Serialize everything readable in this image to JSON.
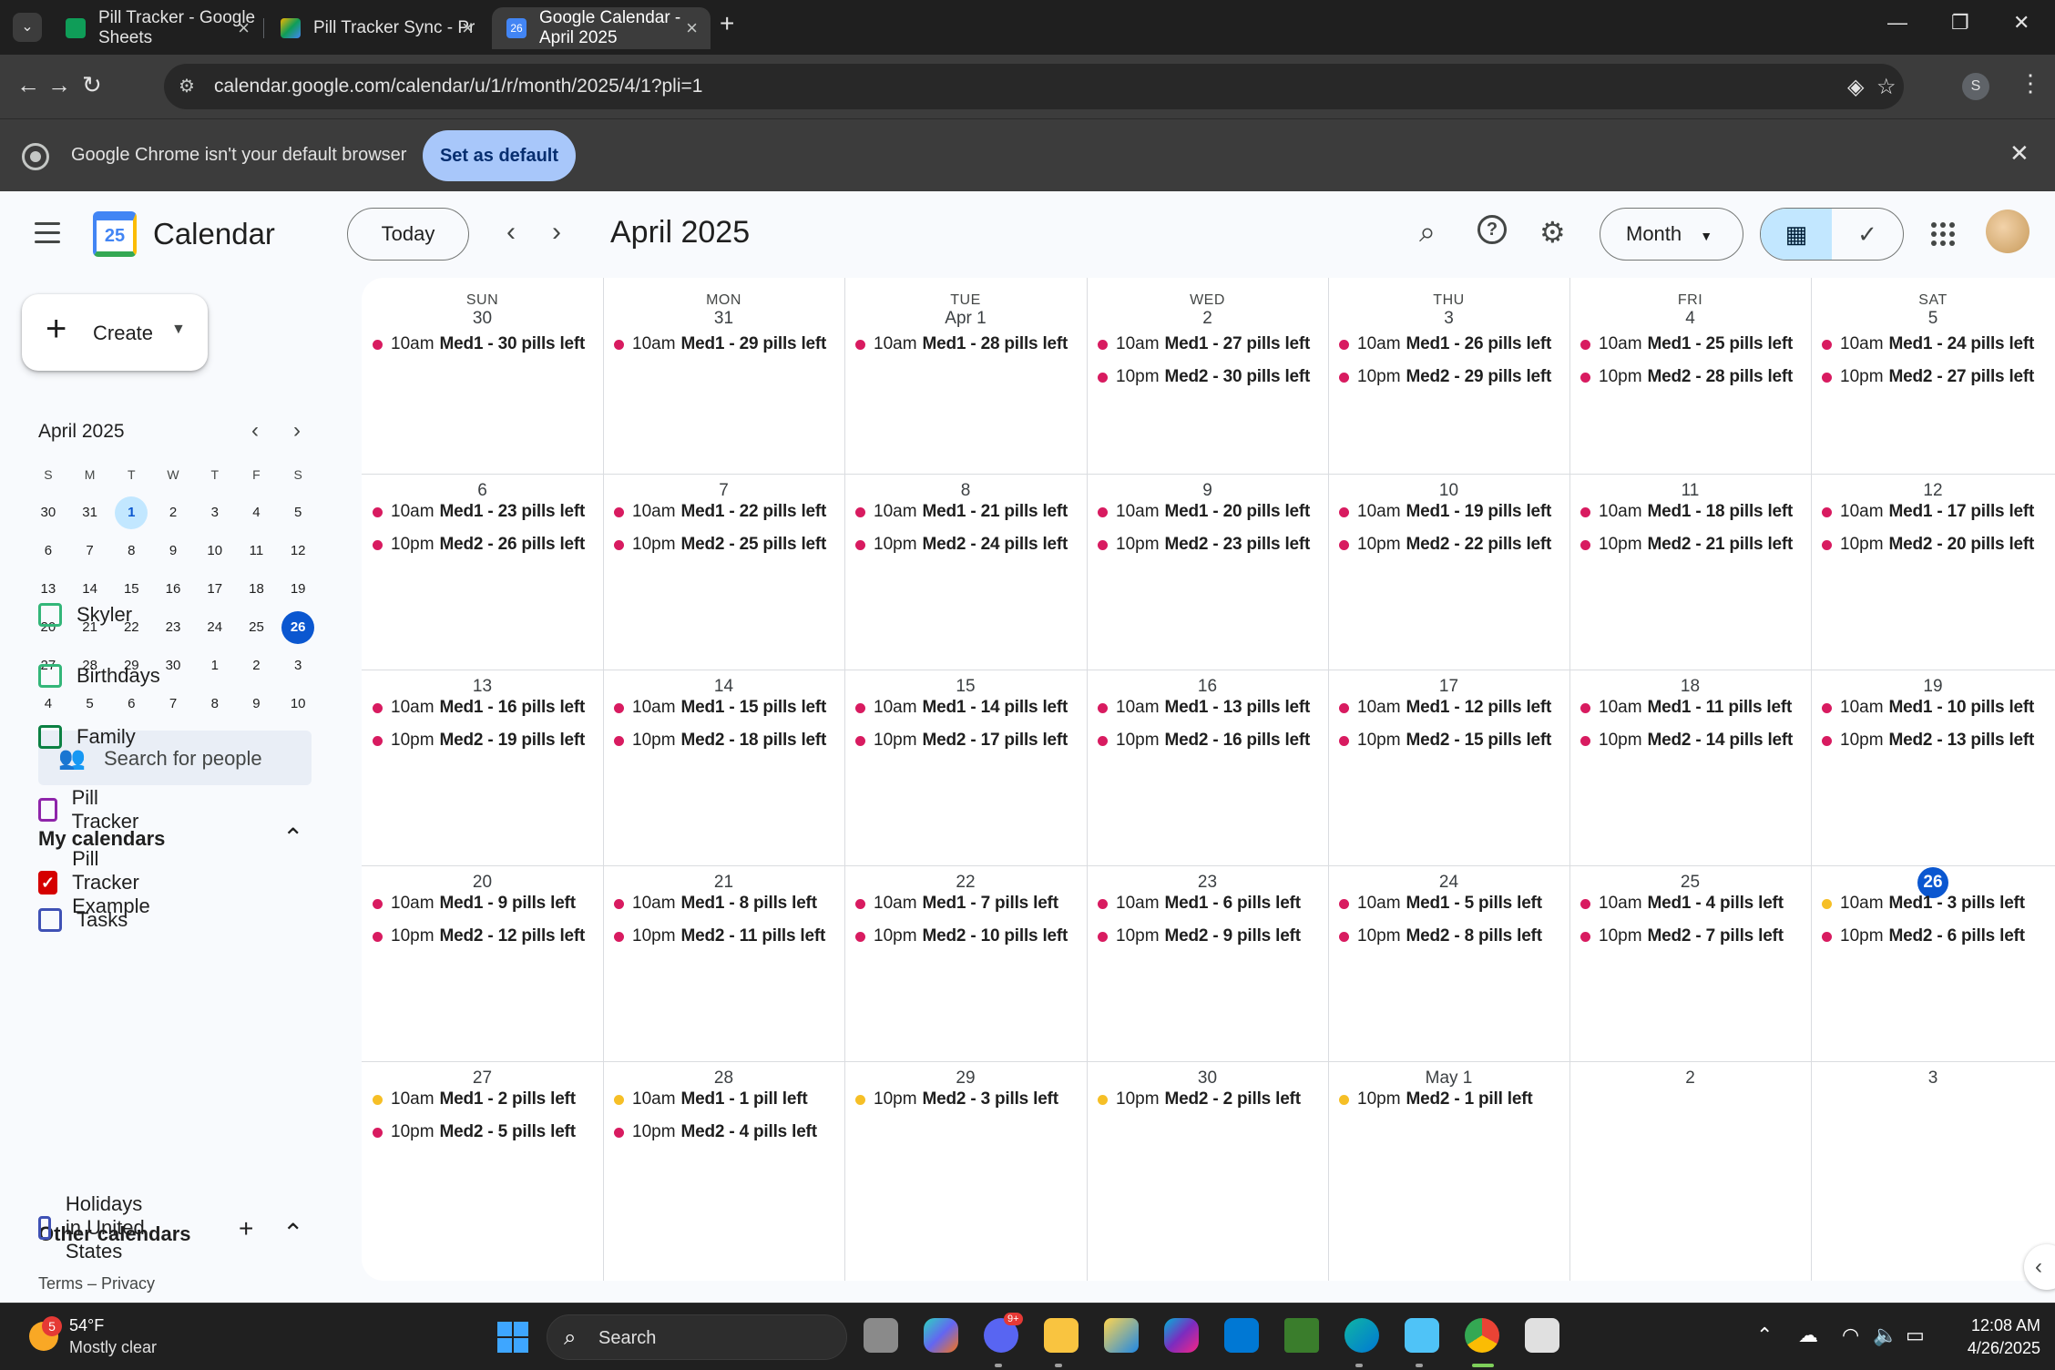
{
  "browser": {
    "tabs": [
      {
        "title": "Pill Tracker - Google Sheets",
        "favicon_color": "#0f9d58"
      },
      {
        "title": "Pill Tracker Sync - Project Editor",
        "favicon_color": "#f4b400"
      },
      {
        "title": "Google Calendar - April 2025",
        "favicon_color": "#4285f4",
        "favicon_text": "26"
      }
    ],
    "url": "calendar.google.com/calendar/u/1/r/month/2025/4/1?pli=1",
    "profile_initial": "S",
    "infobar": {
      "message": "Google Chrome isn't your default browser",
      "button": "Set as default"
    }
  },
  "header": {
    "logo_number": "25",
    "app_name": "Calendar",
    "today_label": "Today",
    "month_title": "April 2025",
    "view_label": "Month"
  },
  "sidebar": {
    "create_label": "Create",
    "mini_cal": {
      "title": "April 2025",
      "dow": [
        "S",
        "M",
        "T",
        "W",
        "T",
        "F",
        "S"
      ],
      "weeks": [
        [
          "30",
          "31",
          "1",
          "2",
          "3",
          "4",
          "5"
        ],
        [
          "6",
          "7",
          "8",
          "9",
          "10",
          "11",
          "12"
        ],
        [
          "13",
          "14",
          "15",
          "16",
          "17",
          "18",
          "19"
        ],
        [
          "20",
          "21",
          "22",
          "23",
          "24",
          "25",
          "26"
        ],
        [
          "27",
          "28",
          "29",
          "30",
          "1",
          "2",
          "3"
        ],
        [
          "4",
          "5",
          "6",
          "7",
          "8",
          "9",
          "10"
        ]
      ]
    },
    "search_people": "Search for people",
    "my_calendars_title": "My calendars",
    "my_calendars": [
      {
        "name": "Skyler",
        "color": "#33b679",
        "checked": false
      },
      {
        "name": "Birthdays",
        "color": "#33b679",
        "checked": false
      },
      {
        "name": "Family",
        "color": "#0b8043",
        "checked": false
      },
      {
        "name": "Pill Tracker",
        "color": "#8e24aa",
        "checked": false
      },
      {
        "name": "Pill Tracker Example",
        "color": "#d50000",
        "checked": true
      },
      {
        "name": "Tasks",
        "color": "#3f51b5",
        "checked": false
      }
    ],
    "other_calendars_title": "Other calendars",
    "other_calendars": [
      {
        "name": "Holidays in United States",
        "color": "#3f51b5",
        "checked": false
      }
    ],
    "terms": "Terms – Privacy"
  },
  "grid": {
    "dow": [
      "SUN",
      "MON",
      "TUE",
      "WED",
      "THU",
      "FRI",
      "SAT"
    ],
    "colors": {
      "pink": "#d81b60",
      "yellow": "#f6bf26"
    },
    "weeks": [
      [
        {
          "day": "30",
          "events": [
            {
              "time": "10am",
              "name": "Med1 - 30 pills left",
              "c": "pink"
            }
          ]
        },
        {
          "day": "31",
          "events": [
            {
              "time": "10am",
              "name": "Med1 - 29 pills left",
              "c": "pink"
            }
          ]
        },
        {
          "day": "Apr 1",
          "events": [
            {
              "time": "10am",
              "name": "Med1 - 28 pills left",
              "c": "pink"
            }
          ]
        },
        {
          "day": "2",
          "events": [
            {
              "time": "10am",
              "name": "Med1 - 27 pills left",
              "c": "pink"
            },
            {
              "time": "10pm",
              "name": "Med2 - 30 pills left",
              "c": "pink"
            }
          ]
        },
        {
          "day": "3",
          "events": [
            {
              "time": "10am",
              "name": "Med1 - 26 pills left",
              "c": "pink"
            },
            {
              "time": "10pm",
              "name": "Med2 - 29 pills left",
              "c": "pink"
            }
          ]
        },
        {
          "day": "4",
          "events": [
            {
              "time": "10am",
              "name": "Med1 - 25 pills left",
              "c": "pink"
            },
            {
              "time": "10pm",
              "name": "Med2 - 28 pills left",
              "c": "pink"
            }
          ]
        },
        {
          "day": "5",
          "events": [
            {
              "time": "10am",
              "name": "Med1 - 24 pills left",
              "c": "pink"
            },
            {
              "time": "10pm",
              "name": "Med2 - 27 pills left",
              "c": "pink"
            }
          ]
        }
      ],
      [
        {
          "day": "6",
          "events": [
            {
              "time": "10am",
              "name": "Med1 - 23 pills left",
              "c": "pink"
            },
            {
              "time": "10pm",
              "name": "Med2 - 26 pills left",
              "c": "pink"
            }
          ]
        },
        {
          "day": "7",
          "events": [
            {
              "time": "10am",
              "name": "Med1 - 22 pills left",
              "c": "pink"
            },
            {
              "time": "10pm",
              "name": "Med2 - 25 pills left",
              "c": "pink"
            }
          ]
        },
        {
          "day": "8",
          "events": [
            {
              "time": "10am",
              "name": "Med1 - 21 pills left",
              "c": "pink"
            },
            {
              "time": "10pm",
              "name": "Med2 - 24 pills left",
              "c": "pink"
            }
          ]
        },
        {
          "day": "9",
          "events": [
            {
              "time": "10am",
              "name": "Med1 - 20 pills left",
              "c": "pink"
            },
            {
              "time": "10pm",
              "name": "Med2 - 23 pills left",
              "c": "pink"
            }
          ]
        },
        {
          "day": "10",
          "events": [
            {
              "time": "10am",
              "name": "Med1 - 19 pills left",
              "c": "pink"
            },
            {
              "time": "10pm",
              "name": "Med2 - 22 pills left",
              "c": "pink"
            }
          ]
        },
        {
          "day": "11",
          "events": [
            {
              "time": "10am",
              "name": "Med1 - 18 pills left",
              "c": "pink"
            },
            {
              "time": "10pm",
              "name": "Med2 - 21 pills left",
              "c": "pink"
            }
          ]
        },
        {
          "day": "12",
          "events": [
            {
              "time": "10am",
              "name": "Med1 - 17 pills left",
              "c": "pink"
            },
            {
              "time": "10pm",
              "name": "Med2 - 20 pills left",
              "c": "pink"
            }
          ]
        }
      ],
      [
        {
          "day": "13",
          "events": [
            {
              "time": "10am",
              "name": "Med1 - 16 pills left",
              "c": "pink"
            },
            {
              "time": "10pm",
              "name": "Med2 - 19 pills left",
              "c": "pink"
            }
          ]
        },
        {
          "day": "14",
          "events": [
            {
              "time": "10am",
              "name": "Med1 - 15 pills left",
              "c": "pink"
            },
            {
              "time": "10pm",
              "name": "Med2 - 18 pills left",
              "c": "pink"
            }
          ]
        },
        {
          "day": "15",
          "events": [
            {
              "time": "10am",
              "name": "Med1 - 14 pills left",
              "c": "pink"
            },
            {
              "time": "10pm",
              "name": "Med2 - 17 pills left",
              "c": "pink"
            }
          ]
        },
        {
          "day": "16",
          "events": [
            {
              "time": "10am",
              "name": "Med1 - 13 pills left",
              "c": "pink"
            },
            {
              "time": "10pm",
              "name": "Med2 - 16 pills left",
              "c": "pink"
            }
          ]
        },
        {
          "day": "17",
          "events": [
            {
              "time": "10am",
              "name": "Med1 - 12 pills left",
              "c": "pink"
            },
            {
              "time": "10pm",
              "name": "Med2 - 15 pills left",
              "c": "pink"
            }
          ]
        },
        {
          "day": "18",
          "events": [
            {
              "time": "10am",
              "name": "Med1 - 11 pills left",
              "c": "pink"
            },
            {
              "time": "10pm",
              "name": "Med2 - 14 pills left",
              "c": "pink"
            }
          ]
        },
        {
          "day": "19",
          "events": [
            {
              "time": "10am",
              "name": "Med1 - 10 pills left",
              "c": "pink"
            },
            {
              "time": "10pm",
              "name": "Med2 - 13 pills left",
              "c": "pink"
            }
          ]
        }
      ],
      [
        {
          "day": "20",
          "events": [
            {
              "time": "10am",
              "name": "Med1 - 9 pills left",
              "c": "pink"
            },
            {
              "time": "10pm",
              "name": "Med2 - 12 pills left",
              "c": "pink"
            }
          ]
        },
        {
          "day": "21",
          "events": [
            {
              "time": "10am",
              "name": "Med1 - 8 pills left",
              "c": "pink"
            },
            {
              "time": "10pm",
              "name": "Med2 - 11 pills left",
              "c": "pink"
            }
          ]
        },
        {
          "day": "22",
          "events": [
            {
              "time": "10am",
              "name": "Med1 - 7 pills left",
              "c": "pink"
            },
            {
              "time": "10pm",
              "name": "Med2 - 10 pills left",
              "c": "pink"
            }
          ]
        },
        {
          "day": "23",
          "events": [
            {
              "time": "10am",
              "name": "Med1 - 6 pills left",
              "c": "pink"
            },
            {
              "time": "10pm",
              "name": "Med2 - 9 pills left",
              "c": "pink"
            }
          ]
        },
        {
          "day": "24",
          "events": [
            {
              "time": "10am",
              "name": "Med1 - 5 pills left",
              "c": "pink"
            },
            {
              "time": "10pm",
              "name": "Med2 - 8 pills left",
              "c": "pink"
            }
          ]
        },
        {
          "day": "25",
          "events": [
            {
              "time": "10am",
              "name": "Med1 - 4 pills left",
              "c": "pink"
            },
            {
              "time": "10pm",
              "name": "Med2 - 7 pills left",
              "c": "pink"
            }
          ]
        },
        {
          "day": "26",
          "today": true,
          "events": [
            {
              "time": "10am",
              "name": "Med1 - 3 pills left",
              "c": "yellow"
            },
            {
              "time": "10pm",
              "name": "Med2 - 6 pills left",
              "c": "pink"
            }
          ]
        }
      ],
      [
        {
          "day": "27",
          "events": [
            {
              "time": "10am",
              "name": "Med1 - 2 pills left",
              "c": "yellow"
            },
            {
              "time": "10pm",
              "name": "Med2 - 5 pills left",
              "c": "pink"
            }
          ]
        },
        {
          "day": "28",
          "events": [
            {
              "time": "10am",
              "name": "Med1 - 1 pill left",
              "c": "yellow"
            },
            {
              "time": "10pm",
              "name": "Med2 - 4 pills left",
              "c": "pink"
            }
          ]
        },
        {
          "day": "29",
          "events": [
            {
              "time": "10pm",
              "name": "Med2 - 3 pills left",
              "c": "yellow"
            }
          ]
        },
        {
          "day": "30",
          "events": [
            {
              "time": "10pm",
              "name": "Med2 - 2 pills left",
              "c": "yellow"
            }
          ]
        },
        {
          "day": "May 1",
          "events": [
            {
              "time": "10pm",
              "name": "Med2 - 1 pill left",
              "c": "yellow"
            }
          ]
        },
        {
          "day": "2",
          "events": []
        },
        {
          "day": "3",
          "events": []
        }
      ]
    ]
  },
  "taskbar": {
    "weather_badge": "5",
    "weather_temp": "54°F",
    "weather_desc": "Mostly clear",
    "search_label": "Search",
    "discord_badge": "9+",
    "time": "12:08 AM",
    "date": "4/26/2025"
  }
}
